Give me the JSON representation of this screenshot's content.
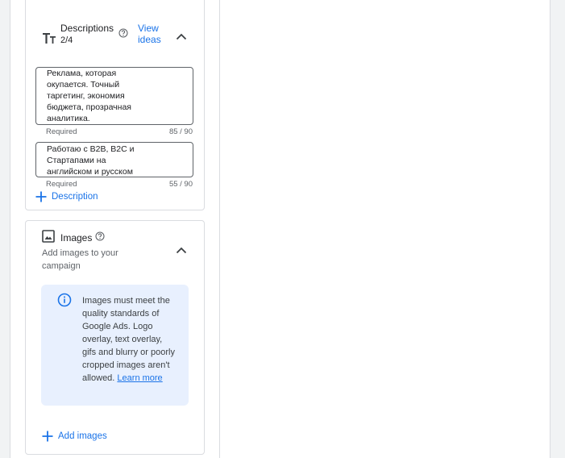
{
  "descriptions": {
    "title": "Descriptions",
    "count": "2/4",
    "view_ideas": "View ideas",
    "icons": {
      "type": "text-format-icon",
      "help": "help-circle-icon",
      "collapse": "chevron-up-icon",
      "add": "plus-icon"
    },
    "items": [
      {
        "value": "Реклама, которая окупается. Точный таргетинг, экономия бюджета, прозрачная аналитика.",
        "helper": "Required",
        "counter": "85 / 90"
      },
      {
        "value": "Работаю с B2B, B2C и Стартапами на английском и русском",
        "helper": "Required",
        "counter": "55 / 90"
      }
    ],
    "add_label": "Description"
  },
  "images": {
    "title": "Images",
    "subtitle": "Add images to your campaign",
    "icons": {
      "image": "image-icon",
      "help": "help-circle-icon",
      "collapse": "chevron-up-icon",
      "info": "info-icon",
      "add": "plus-icon"
    },
    "notice_text": "Images must meet the quality standards of Google Ads. Logo overlay, text overlay, gifs and blurry or poorly cropped images aren't allowed.",
    "notice_link": "Learn more",
    "add_label": "Add images"
  },
  "colors": {
    "accent": "#1a73e8",
    "notice_bg": "#e8f0fe",
    "border": "#dadce0",
    "muted_text": "#5f6368"
  }
}
